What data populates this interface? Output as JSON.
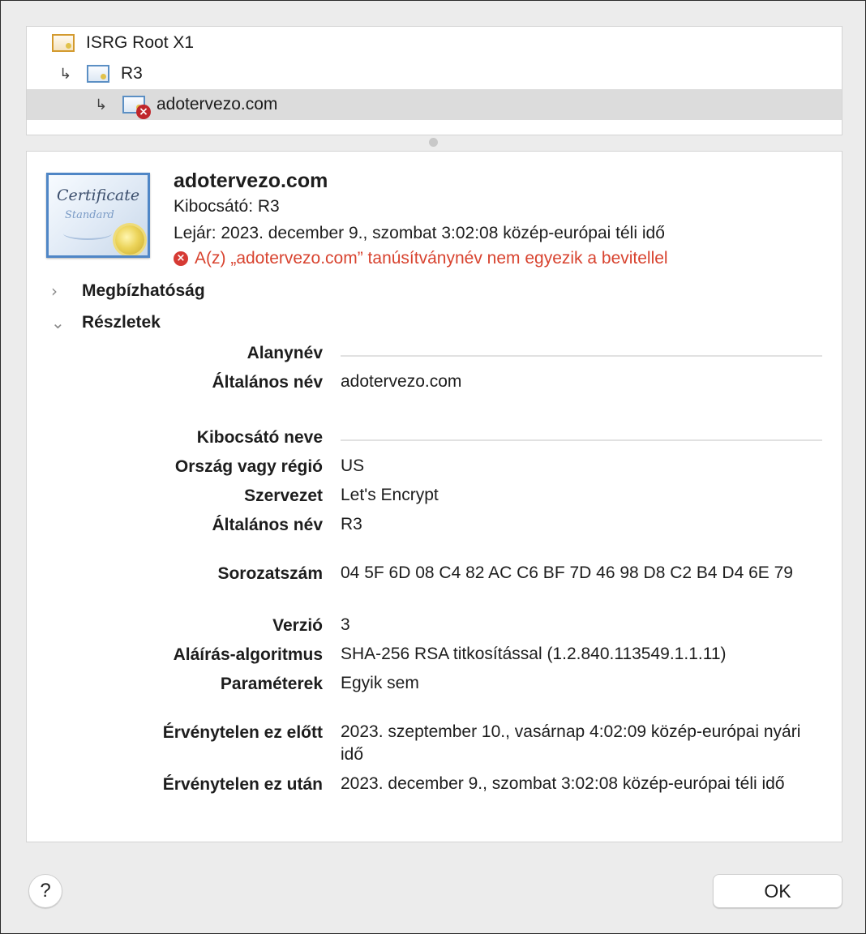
{
  "tree": {
    "items": [
      {
        "label": "ISRG Root X1"
      },
      {
        "label": "R3"
      },
      {
        "label": "adotervezo.com"
      }
    ]
  },
  "header": {
    "title": "adotervezo.com",
    "issuer": "Kibocsátó: R3",
    "expires": "Lejár: 2023. december 9., szombat 3:02:08 közép-európai téli idő",
    "error": "A(z) „adotervezo.com” tanúsítványnév nem egyezik a bevitellel",
    "cert_image": {
      "line1": "Certificate",
      "line2": "Standard"
    }
  },
  "sections": {
    "trust": "Megbízhatóság",
    "details": "Részletek"
  },
  "details": {
    "subject_header": "Alanynév",
    "subject_cn_label": "Általános név",
    "subject_cn": "adotervezo.com",
    "issuer_header": "Kibocsátó neve",
    "country_label": "Ország vagy régió",
    "country": "US",
    "org_label": "Szervezet",
    "org": "Let's Encrypt",
    "issuer_cn_label": "Általános név",
    "issuer_cn": "R3",
    "serial_label": "Sorozatszám",
    "serial": "04 5F 6D 08 C4 82 AC C6 BF 7D 46 98 D8 C2 B4 D4 6E 79",
    "version_label": "Verzió",
    "version": "3",
    "sigalg_label": "Aláírás-algoritmus",
    "sigalg": "SHA-256 RSA titkosítással (1.2.840.113549.1.1.11)",
    "params_label": "Paraméterek",
    "params": "Egyik sem",
    "notbefore_label": "Érvénytelen ez előtt",
    "notbefore": "2023. szeptember 10., vasárnap 4:02:09 közép-európai nyári idő",
    "notafter_label": "Érvénytelen ez után",
    "notafter": "2023. december 9., szombat 3:02:08 közép-európai téli idő"
  },
  "buttons": {
    "help": "?",
    "ok": "OK"
  },
  "colors": {
    "error": "#d8432f",
    "selection": "#dcdcdc"
  },
  "icons": {
    "tree_arrow": "↳",
    "collapsed": "›",
    "expanded": "⌄"
  }
}
